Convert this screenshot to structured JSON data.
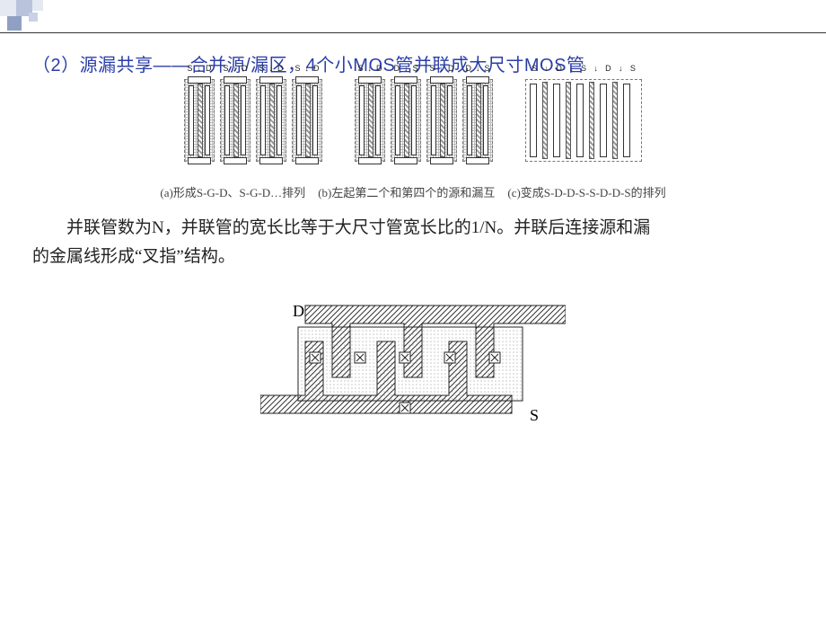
{
  "title": "（2）源漏共享——合并源/漏区，4个小MOS管并联成大尺寸MOS管",
  "captions": {
    "a": "(a)形成S-G-D、S-G-D…排列",
    "b": "(b)左起第二个和第四个的源和漏互",
    "c": "(c)变成S-D-D-S-S-D-D-S的排列"
  },
  "mos_labels_a": [
    "S",
    "↓",
    "D"
  ],
  "mos_labels_b1": [
    "S",
    "↓",
    "D"
  ],
  "mos_labels_b2": [
    "D",
    "↓",
    "S"
  ],
  "merged_labels": [
    "S",
    "↓",
    "D",
    "↓",
    "S",
    "↓",
    "D",
    "↓",
    "S"
  ],
  "bodytext_line1": "并联管数为N，并联管的宽长比等于大尺寸管宽长比的1/N。并联后连接源和漏",
  "bodytext_line2": "的金属线形成“叉指”结构。",
  "fork_labels": {
    "D": "D",
    "S": "S"
  }
}
